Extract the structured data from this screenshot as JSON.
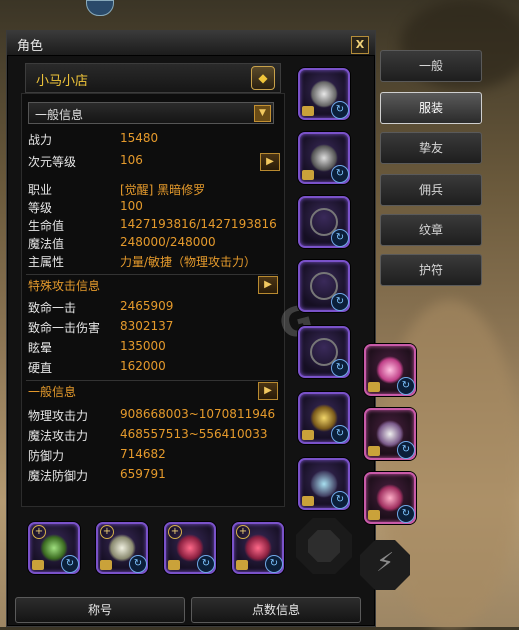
{
  "window": {
    "title": "角色",
    "close_label": "X"
  },
  "shop": {
    "name": "小马小店"
  },
  "dropdown": {
    "selected": "一般信息"
  },
  "stats": [
    {
      "key": "战力",
      "value": "15480"
    },
    {
      "key": "次元等级",
      "value": "106"
    },
    {
      "key": "职业",
      "value": "[觉醒] 黑暗修罗"
    },
    {
      "key": "等级",
      "value": "100"
    },
    {
      "key": "生命值",
      "value": "1427193816/1427193816"
    },
    {
      "key": "魔法值",
      "value": "248000/248000"
    },
    {
      "key": "主属性",
      "value": "力量/敏捷（物理攻击力）"
    },
    {
      "key": "致命一击",
      "value": "2465909"
    },
    {
      "key": "致命一击伤害",
      "value": "8302137"
    },
    {
      "key": "眩晕",
      "value": "135000"
    },
    {
      "key": "硬直",
      "value": "162000"
    },
    {
      "key": "物理攻击力",
      "value": "908668003~1070811946"
    },
    {
      "key": "魔法攻击力",
      "value": "468557513~556410033"
    },
    {
      "key": "防御力",
      "value": "714682"
    },
    {
      "key": "魔法防御力",
      "value": "659791"
    }
  ],
  "sections": {
    "special_attack": "特殊攻击信息",
    "general": "一般信息"
  },
  "tabs": [
    {
      "label": "一般",
      "active": false
    },
    {
      "label": "服装",
      "active": true
    },
    {
      "label": "挚友",
      "active": false
    },
    {
      "label": "佣兵",
      "active": false
    },
    {
      "label": "纹章",
      "active": false
    },
    {
      "label": "护符",
      "active": false
    }
  ],
  "bottom_buttons": {
    "title": "称号",
    "points": "点数信息"
  },
  "icons": {
    "close": "close-icon",
    "shop_toggle": "diamond-arrow-icon",
    "dropdown": "chevron-down-icon",
    "expand": "chevron-right-icon",
    "sync": "refresh-icon",
    "lock": "lock-icon",
    "plus": "plus-icon",
    "lightning": "lightning-icon"
  },
  "colors": {
    "accent": "#e59a2c",
    "shop": "#f0c53a",
    "slot_border": "#7a52c9"
  }
}
